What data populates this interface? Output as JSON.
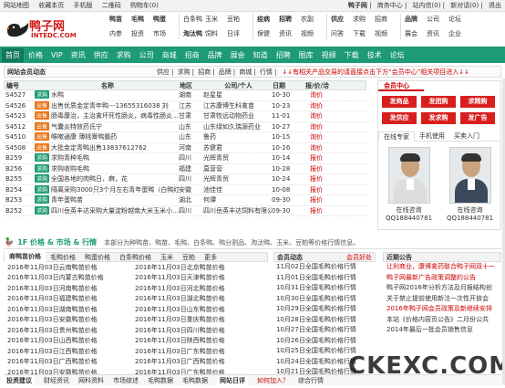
{
  "topbar": {
    "left": [
      "网站地图",
      "收藏本页",
      "手机版",
      "二维码",
      "购物车(0)"
    ],
    "right": [
      "鸭子网",
      "商务中心",
      "站内信(0)",
      "新对话(0)",
      "退出"
    ]
  },
  "logo": {
    "name": "鸭子网",
    "domain": "INTEDC.COM"
  },
  "header_cols": [
    [
      "鸭苗",
      "毛鸭",
      "鸭蛋",
      "内参",
      "投资",
      "市场"
    ],
    [
      "白条鸭",
      "玉米",
      "豆粕",
      "淘汰鸭",
      "饲料",
      "日评"
    ],
    [
      "疫病",
      "招聘",
      "农副",
      "保健",
      "资讯",
      "视频"
    ],
    [
      "供应",
      "求购",
      "招商",
      "问答",
      "下载",
      "视频"
    ],
    [
      "品牌",
      "公司",
      "论坛",
      "展会",
      "资讯",
      "企业"
    ]
  ],
  "header_bold": [
    "鸭苗",
    "毛鸭",
    "鸭蛋",
    "淘汰鸭",
    "疫病",
    "招聘",
    "供应",
    "品牌"
  ],
  "nav": [
    "首页",
    "价格",
    "VIP",
    "资讯",
    "供应",
    "求购",
    "公司",
    "商城",
    "招商",
    "品牌",
    "展会",
    "知道",
    "招聘",
    "图库",
    "视频",
    "下载",
    "技术",
    "论坛"
  ],
  "bar2": {
    "title": "网站会员动态",
    "links": [
      "供应",
      "求购",
      "招商",
      "品牌",
      "商城",
      "行情"
    ],
    "notice": "↓↓有相关产品交易的请直接点击下方“会员中心”相关项目进入↓↓"
  },
  "table": {
    "headers": [
      "编号",
      "名称",
      "地区",
      "公司/个人",
      "日期",
      "报/价/洽"
    ],
    "rows": [
      {
        "id": "S4527",
        "tag": "求购",
        "name": "水鸭",
        "region": "湖南",
        "company": "赵星星",
        "date": "10-30",
        "act": "询价"
      },
      {
        "id": "S4526",
        "tag": "出售",
        "name": "出售优质金定青年鸭---13655316038 刘",
        "region": "江苏",
        "company": "江苏康博生科禽苗",
        "date": "10-23",
        "act": "询价"
      },
      {
        "id": "S4523",
        "tag": "出售",
        "name": "肠毒康治，主治禽坏死性肠炎，病毒性肠炎...",
        "region": "甘肃",
        "company": "甘肃牧远动物药业",
        "date": "11-01",
        "act": "询价"
      },
      {
        "id": "S4512",
        "tag": "出售",
        "name": "气囊炎特效药氏宁",
        "region": "山东",
        "company": "山东绿如久瑞源药业",
        "date": "10-27",
        "act": "询价"
      },
      {
        "id": "S4510",
        "tag": "出售",
        "name": "喉嗽通康 薄桃膏鸭霸药",
        "region": "山东",
        "company": "鲁药",
        "date": "10-15",
        "act": "询价"
      },
      {
        "id": "S4508",
        "tag": "出售",
        "name": "大批金定青鸭出售13837612762",
        "region": "河南",
        "company": "苏健君",
        "date": "10-26",
        "act": "询价"
      },
      {
        "id": "B259",
        "tag": "求购",
        "name": "求购青种毛鸭",
        "region": "四川",
        "company": "光辉青贸",
        "date": "10-14",
        "act": "报价"
      },
      {
        "id": "B256",
        "tag": "求购",
        "name": "求购收购毛鸭",
        "region": "福建",
        "company": "莫营营",
        "date": "10-28",
        "act": "报价"
      },
      {
        "id": "B255",
        "tag": "求购",
        "name": "全国各地的肉鸭日，麻，花",
        "region": "四川",
        "company": "光辉青贸",
        "date": "10-24",
        "act": "报价"
      },
      {
        "id": "B254",
        "tag": "求购",
        "name": "隔离采购3000只3个月左右青年蛋鸭（白鸭红...",
        "region": "安徽",
        "company": "池佳佳",
        "date": "10-08",
        "act": "报价"
      },
      {
        "id": "B253",
        "tag": "求购",
        "name": "青年蛋鸭苗",
        "region": "湖北",
        "company": "何谭",
        "date": "09-30",
        "act": "报价"
      },
      {
        "id": "B252",
        "tag": "求购",
        "name": "四川岳英丰达采购大量淀粉越南大米玉米小...",
        "region": "四川",
        "company": "四川岳英丰达饲料有限公司",
        "date": "09-30",
        "act": "报价"
      }
    ]
  },
  "rpanel": {
    "title": "会员中心",
    "buttons": [
      "发商品",
      "发团购",
      "求精购",
      "发供应",
      "发求购",
      "发广告"
    ],
    "tabs": [
      "在线专家",
      "手机使用",
      "买卖入门"
    ],
    "experts": [
      {
        "name": "在线咨询",
        "qq": "QQ188440781"
      },
      {
        "name": "在线咨询",
        "qq": "QQ188440781"
      }
    ]
  },
  "sec2": {
    "title": "1F 价格 & 市场 & 行情",
    "desc": "本部分为种鸭苗、鸭苗、毛鸭、白条鸭、鸭分割品、淘汰鸭、玉米、豆粕等价格行情信息。"
  },
  "leftlist": {
    "tabs": [
      "商鸭苗价格",
      "毛鸭价格",
      "鸭蛋价格",
      "白条鸭价格",
      "玉米",
      "豆粕",
      "更多"
    ],
    "rows": [
      [
        "2016年11月03日云南鸭苗价格",
        "2016年11月03日北京鸭苗价格"
      ],
      [
        "2016年11月03日内蒙古鸭苗价格",
        "2016年11月03日天津鸭苗价格"
      ],
      [
        "2016年11月03日河南鸭苗价格",
        "2016年11月03日河北鸭苗价格"
      ],
      [
        "2016年11月03日福建鸭苗价格",
        "2016年11月03日湖北鸭苗价格"
      ],
      [
        "2016年11月03日湖南鸭苗价格",
        "2016年11月03日山东鸭苗价格"
      ],
      [
        "2016年11月03日安徽鸭苗价格",
        "2016年11月03日重庆鸭苗价格"
      ],
      [
        "2016年11月03日贵州鸭苗价格",
        "2016年11月03日四川鸭苗价格"
      ],
      [
        "2016年11月03日山西鸭苗价格",
        "2016年11月03日陕西鸭苗价格"
      ],
      [
        "2016年11月03日江西鸭苗价格",
        "2016年11月03日广东鸭苗价格"
      ],
      [
        "2016年11月03日广西鸭苗价格",
        "2016年11月03日广西鸭苗价格"
      ],
      [
        "2016年11月03日安徽鸭苗价格",
        "2016年11月03日广东鸭苗价格"
      ],
      [
        "2016年11月03日辽宁鸭苗价格",
        "2016年11月03日江苏鸭苗价格"
      ]
    ]
  },
  "midlist": {
    "title": "会员动态",
    "more": "会员好处",
    "rows": [
      "11月02日全国毛鸭价格行情",
      "11月01日全国毛鸭价格行情",
      "10月31日全国毛鸭价格行情",
      "10月30日全国毛鸭价格行情",
      "10月29日全国毛鸭价格行情",
      "10月28日全国毛鸭价格行情",
      "10月27日全国毛鸭价格行情",
      "10月26日全国毛鸭价格行情",
      "10月25日全国毛鸭价格行情",
      "10月24日全国毛鸭价格行情",
      "10月21日全国毛鸭价格行情",
      "10月20日全国毛鸭价格行情"
    ]
  },
  "annlist": {
    "title": "近期公告",
    "rows": [
      {
        "text": "让利商业，康博禽药联合鸭子网双十一",
        "red": true
      },
      {
        "text": "鸭子网最新广告政策调整的公告",
        "red": true
      },
      {
        "text": "鸭子网2016年分析方法及月报结构创",
        "red": false
      },
      {
        "text": "关于禁止提前使用新注一次性开放会",
        "red": false
      },
      {
        "text": "2016年鸭子网会员政策及新继续安排",
        "red": true
      },
      {
        "text": "本站《价格内容页公告》二月份公共",
        "red": false
      },
      {
        "text": "2014年最后一批会员销售信息",
        "red": false
      }
    ]
  },
  "botbar": [
    "投资建议",
    "财经资讯",
    "网科资料",
    "市场综述",
    "毛鸭数据",
    "毛鸭数据",
    "网站日评",
    "如何加入？",
    "综合行情"
  ],
  "watermark": "CKEXC.COM",
  "colors": {
    "green": "#1c9b74",
    "red": "#d91e1e"
  }
}
